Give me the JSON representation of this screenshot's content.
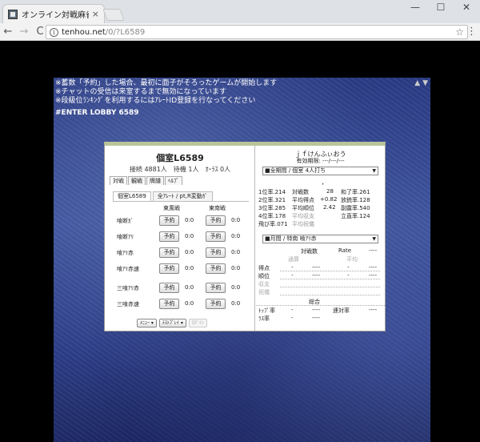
{
  "browser": {
    "tab_title": "オンライン対戦麻雀 天鳳 /",
    "tab_close": "×",
    "min_glyph": "—",
    "max_glyph": "☐",
    "close_glyph": "✕",
    "url_host": "tenhou.net",
    "url_path": "/0/?L6589",
    "back_glyph": "←",
    "forward_glyph": "→",
    "reload_glyph": "C",
    "star_glyph": "☆",
    "menu_glyph": "⋮",
    "info_glyph": "i"
  },
  "notice": {
    "lines": [
      "※蓄数「予約」した場合、最初に面子がそろったゲームが開始します",
      "※チャットの受信は来室するまで無効になっています",
      "※段級位ﾗﾝｷﾝｸﾞを利用するにはｱﾚｰﾄID登録を行なってください"
    ],
    "enter_lobby": "#ENTER LOBBY 6589",
    "corner_icons": "▲ ▼"
  },
  "lobby": {
    "room_title": "個室L6589",
    "stats": "接続 4881人　待機 1人　ｵｰﾗｽ 0人",
    "tabs": [
      "対戦",
      "観戦",
      "牌譜",
      "ﾍﾙﾌﾟ"
    ],
    "subtabs": [
      "個室L6589",
      "全ｱﾚｰﾄ / pt,R変動ｶﾞ"
    ],
    "col_east": "東風戦",
    "col_south": "東南戦",
    "rules": [
      {
        "name": "喰断ｶﾞ",
        "east_btn": "予約",
        "east_score": "0:0",
        "south_btn": "予約",
        "south_score": "0:0"
      },
      {
        "name": "喰断ｱﾘ",
        "east_btn": "予約",
        "east_score": "0:0",
        "south_btn": "予約",
        "south_score": "0:0"
      },
      {
        "name": "喰ｱﾘ赤",
        "east_btn": "予約",
        "east_score": "0:0",
        "south_btn": "予約",
        "south_score": "0:0"
      },
      {
        "name": "喰ｱﾘ赤速",
        "east_btn": "予約",
        "east_score": "0:0",
        "south_btn": "予約",
        "south_score": "0:0"
      },
      {
        "name": "三喰ｱﾘ赤",
        "east_btn": "予約",
        "east_score": "0:0",
        "south_btn": "予約",
        "south_score": "0:0"
      },
      {
        "name": "三喰赤速",
        "east_btn": "予約",
        "east_score": "0:0",
        "south_btn": "予約",
        "south_score": "0:0"
      }
    ],
    "menu_btn": "ﾒﾆｭｰ ▾",
    "testplay_btn": "ﾃｽﾄﾌﾟﾚｲ ▾",
    "disabled_btn": "ﾛｸﾞｲﾝ"
  },
  "stats": {
    "player_name": "ｊｆけんふぃおう",
    "valid_period": "有効期限: ---/---/---",
    "period_select": "■全期間 / 個室 4人打ち",
    "sep": "・",
    "left": [
      "1位率.214",
      "2位率.321",
      "3位率.285",
      "4位率.178",
      "飛び率.071"
    ],
    "mid_labels": [
      "対戦数",
      "平均得点",
      "平均順位",
      "平均収支",
      "平均祝儀"
    ],
    "mid_values": [
      "28",
      "+0.82",
      "2.42",
      "",
      ""
    ],
    "right": [
      "和了率.261",
      "放銃率.128",
      "副露率.540",
      "立直率.124"
    ],
    "rule_select": "■月間 / 特南 喰ｱﾘ赤",
    "head_games": "対戦数",
    "head_rate": "Rate",
    "head_rate_val": "----",
    "sub_pass": "通算",
    "sub_avg": "平均",
    "rows2": [
      "得点",
      "順位",
      "収支",
      "祝儀"
    ],
    "total_label": "総合",
    "top_rate": "ﾄｯﾌﾟ率",
    "last_rate": "ﾗｽ率",
    "renpai": "連対率",
    "dash": "-",
    "dashes": "----"
  }
}
